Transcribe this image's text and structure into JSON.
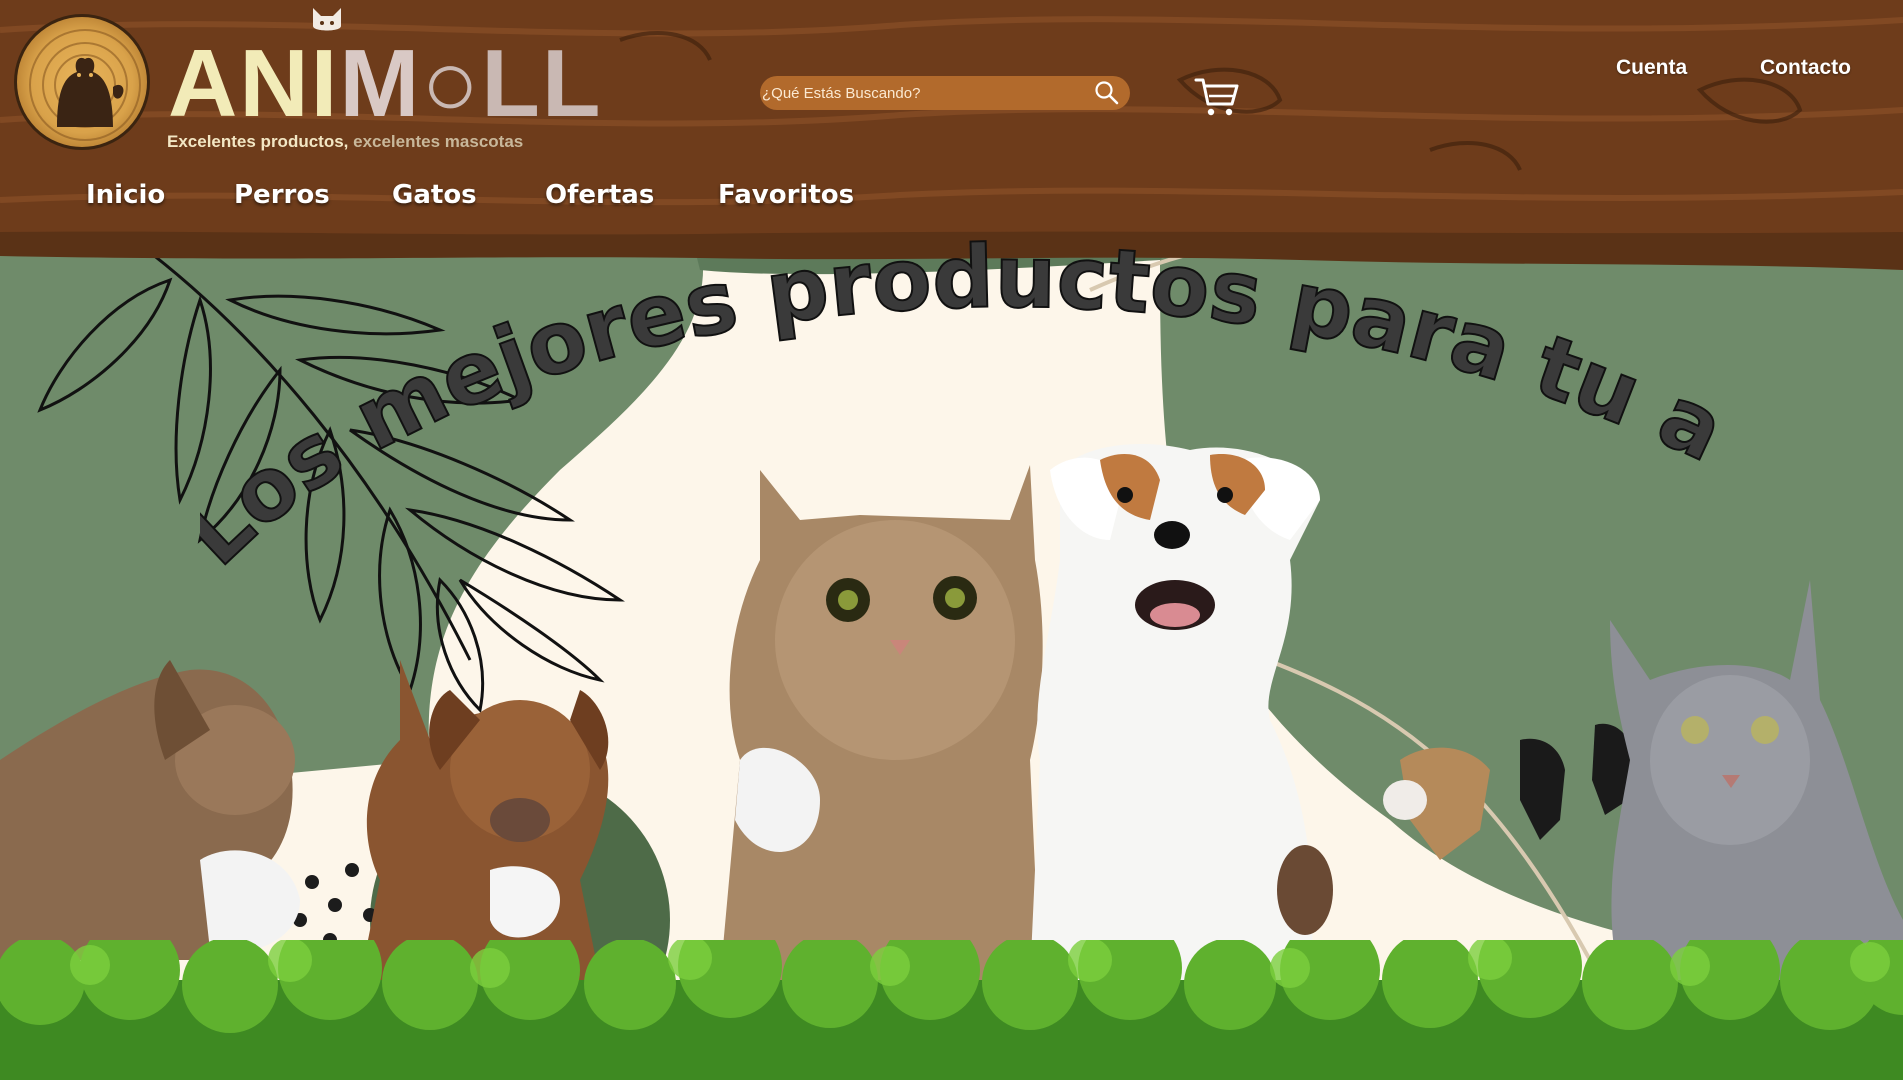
{
  "header": {
    "brand": {
      "part1": "ANI",
      "part2": "M",
      "part3": "LL"
    },
    "tagline": {
      "part1": "Excelentes productos,",
      "part2": " excelentes mascotas"
    },
    "search": {
      "placeholder": "¿Qué Estás Buscando?",
      "value": ""
    },
    "top_links": {
      "account": "Cuenta",
      "contact": "Contacto"
    },
    "nav": [
      "Inicio",
      "Perros",
      "Gatos",
      "Ofertas",
      "Favoritos"
    ]
  },
  "hero": {
    "headline": "Los mejores productos para tu amigo"
  },
  "colors": {
    "wood_dark": "#5a3216",
    "wood_mid": "#7b4423",
    "sage": "#6f8b6a",
    "cream": "#fdf6ea",
    "hedge": "#4a9a2a",
    "search_bg": "#b26a2c"
  },
  "icons": {
    "search": "search-icon",
    "cart": "cart-icon",
    "logo": "bear-logo-icon"
  }
}
